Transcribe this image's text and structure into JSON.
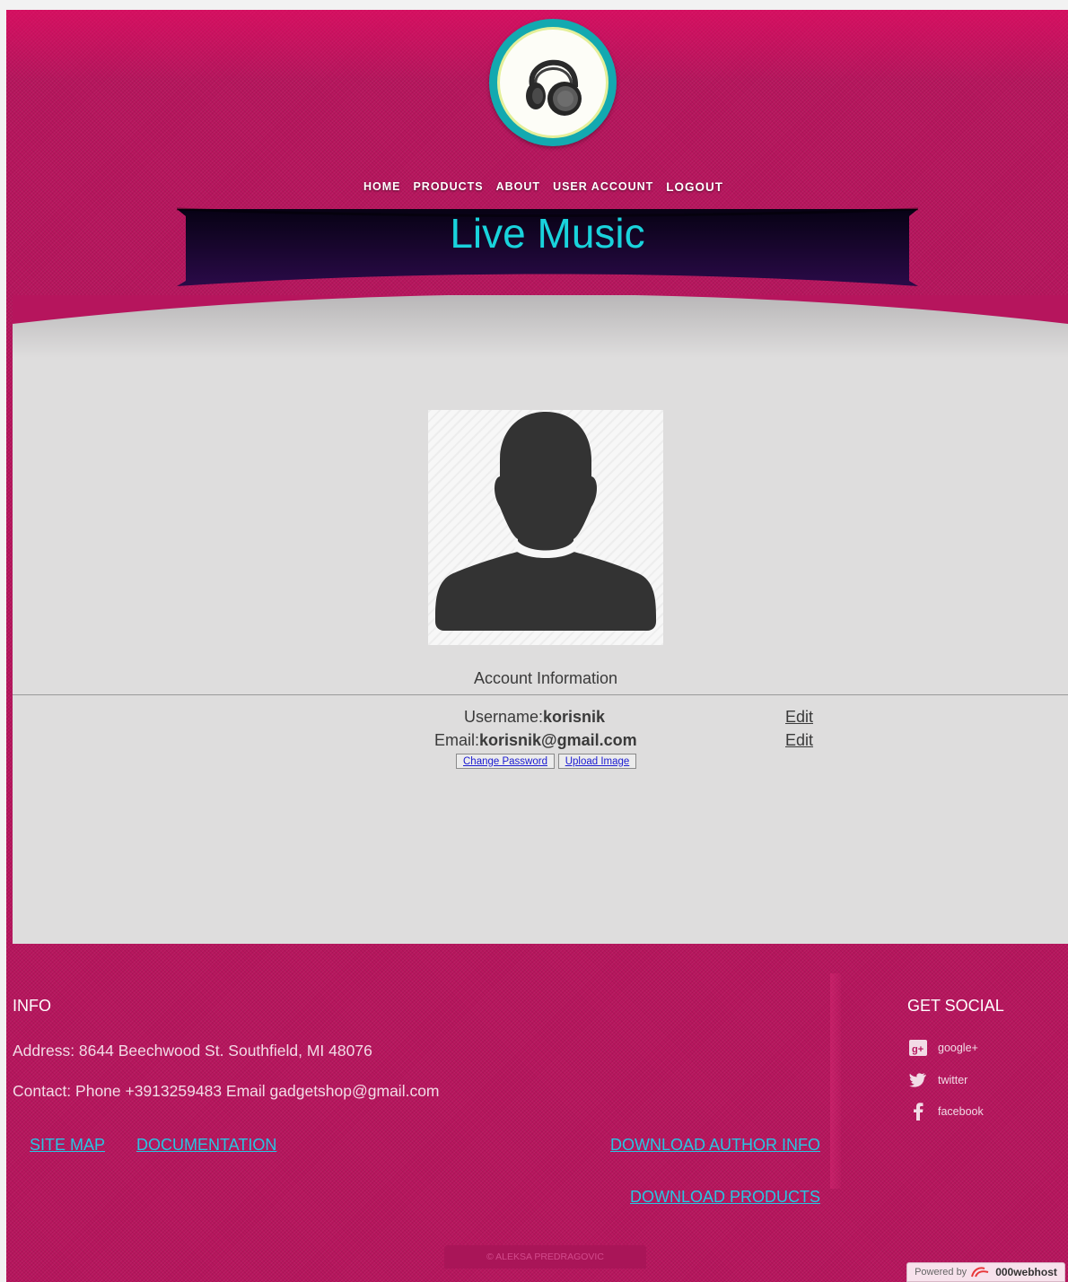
{
  "nav": {
    "home": "HOME",
    "products": "PRODUCTS",
    "about": "ABOUT",
    "user_account": "USER ACCOUNT",
    "logout": "LOGOUT"
  },
  "banner": {
    "title": "Live Music"
  },
  "account": {
    "title": "Account Information",
    "username_label": "Username:",
    "username_value": "korisnik",
    "email_label": "Email:",
    "email_value": "korisnik@gmail.com",
    "edit_label": "Edit",
    "change_password": "Change Password",
    "upload_image": "Upload Image"
  },
  "footer": {
    "info_title": "INFO",
    "address": "Address: 8644 Beechwood St. Southfield, MI 48076",
    "contact": "Contact: Phone +3913259483 Email gadgetshop@gmail.com",
    "site_map": "SITE MAP",
    "documentation": "DOCUMENTATION",
    "download_author_info": "DOWNLOAD AUTHOR INFO",
    "download_products": "DOWNLOAD PRODUCTS",
    "social_title": "GET SOCIAL",
    "social": [
      {
        "label": "google+",
        "icon": "google-plus-icon"
      },
      {
        "label": "twitter",
        "icon": "twitter-icon"
      },
      {
        "label": "facebook",
        "icon": "facebook-icon"
      }
    ],
    "copyright": "© ALEKSA PREDRAGOVIC",
    "powered_by": "Powered by",
    "host_name": "000webhost"
  },
  "colors": {
    "page_background": "#b6155d",
    "accent_cyan": "#19d3dc",
    "link_cyan": "#27c6e2",
    "content_background": "#dedddd"
  }
}
